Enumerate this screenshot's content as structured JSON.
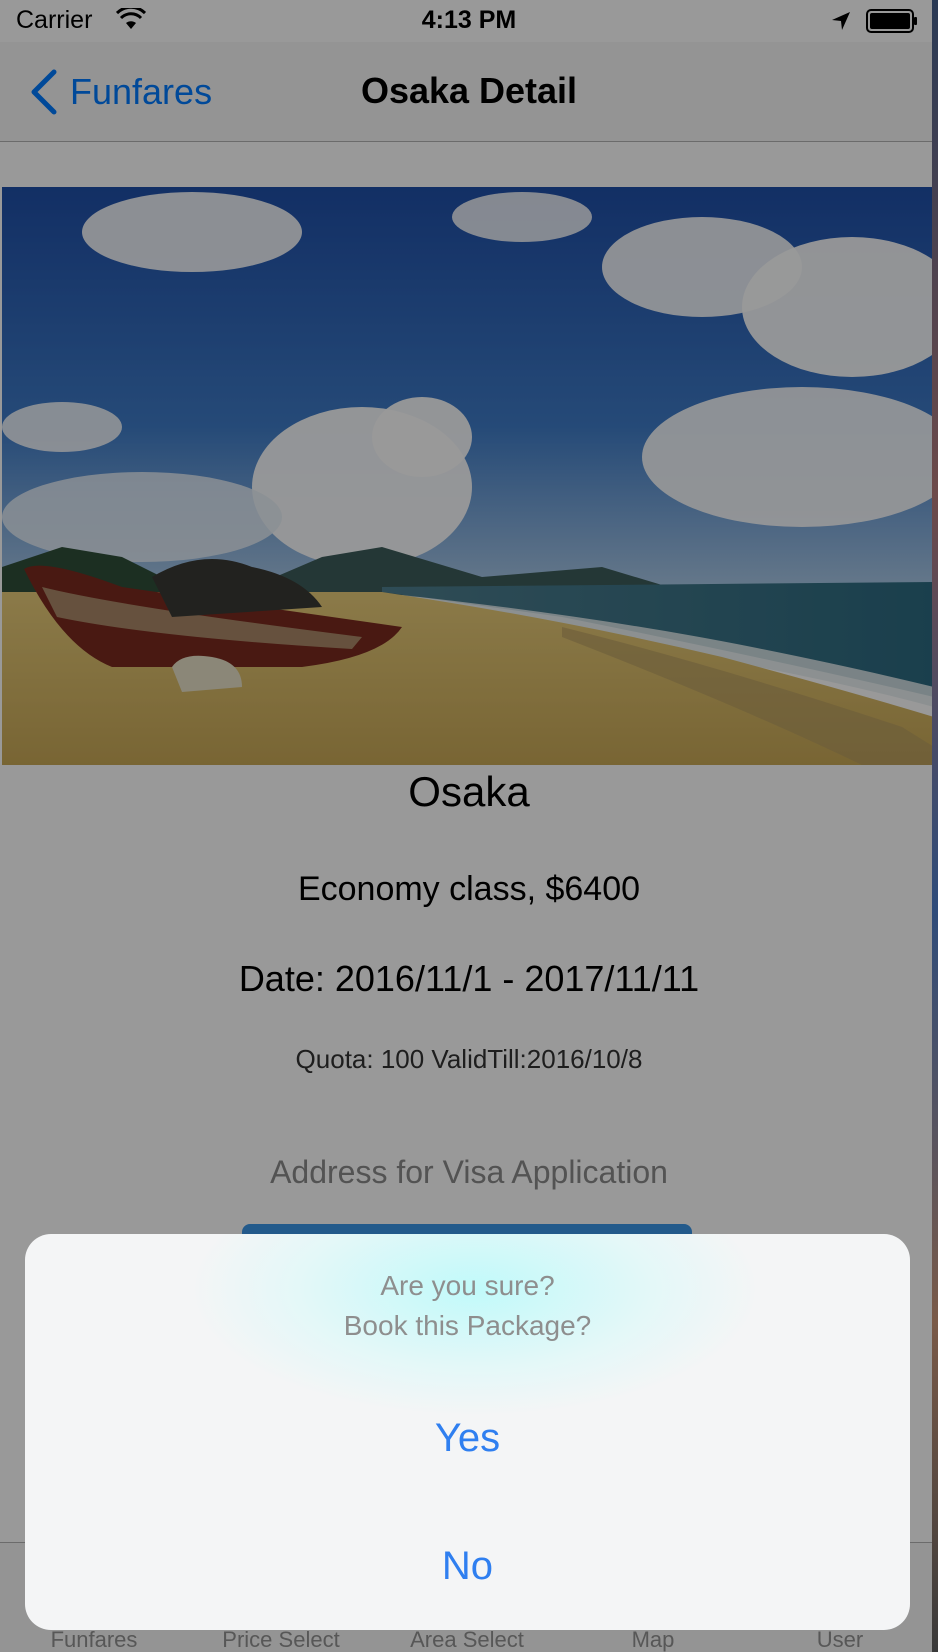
{
  "status_bar": {
    "carrier": "Carrier",
    "time": "4:13 PM",
    "icons": [
      "wifi-icon",
      "location-arrow-icon",
      "battery-icon"
    ]
  },
  "nav": {
    "back_label": "Funfares",
    "title": "Osaka Detail",
    "back_icon": "chevron-left-icon"
  },
  "detail": {
    "destination": "Osaka",
    "class_price": "Economy class, $6400",
    "date_range": "Date: 2016/11/1 - 2017/11/11",
    "quota": "Quota: 100 ValidTill:2016/10/8",
    "visa_address_label": "Address for Visa Application"
  },
  "alert": {
    "title": "Are you sure?",
    "message": "Book this Package?",
    "yes_label": "Yes",
    "no_label": "No"
  },
  "tabbar": {
    "tabs": [
      {
        "label": "Funfares"
      },
      {
        "label": "Price Select"
      },
      {
        "label": "Area Select"
      },
      {
        "label": "Map"
      },
      {
        "label": "User"
      }
    ]
  },
  "colors": {
    "accent": "#007aff",
    "alert_button": "#2f7ff0",
    "book_button": "#3b96e8",
    "overlay": "rgba(0,0,0,0.40)"
  }
}
